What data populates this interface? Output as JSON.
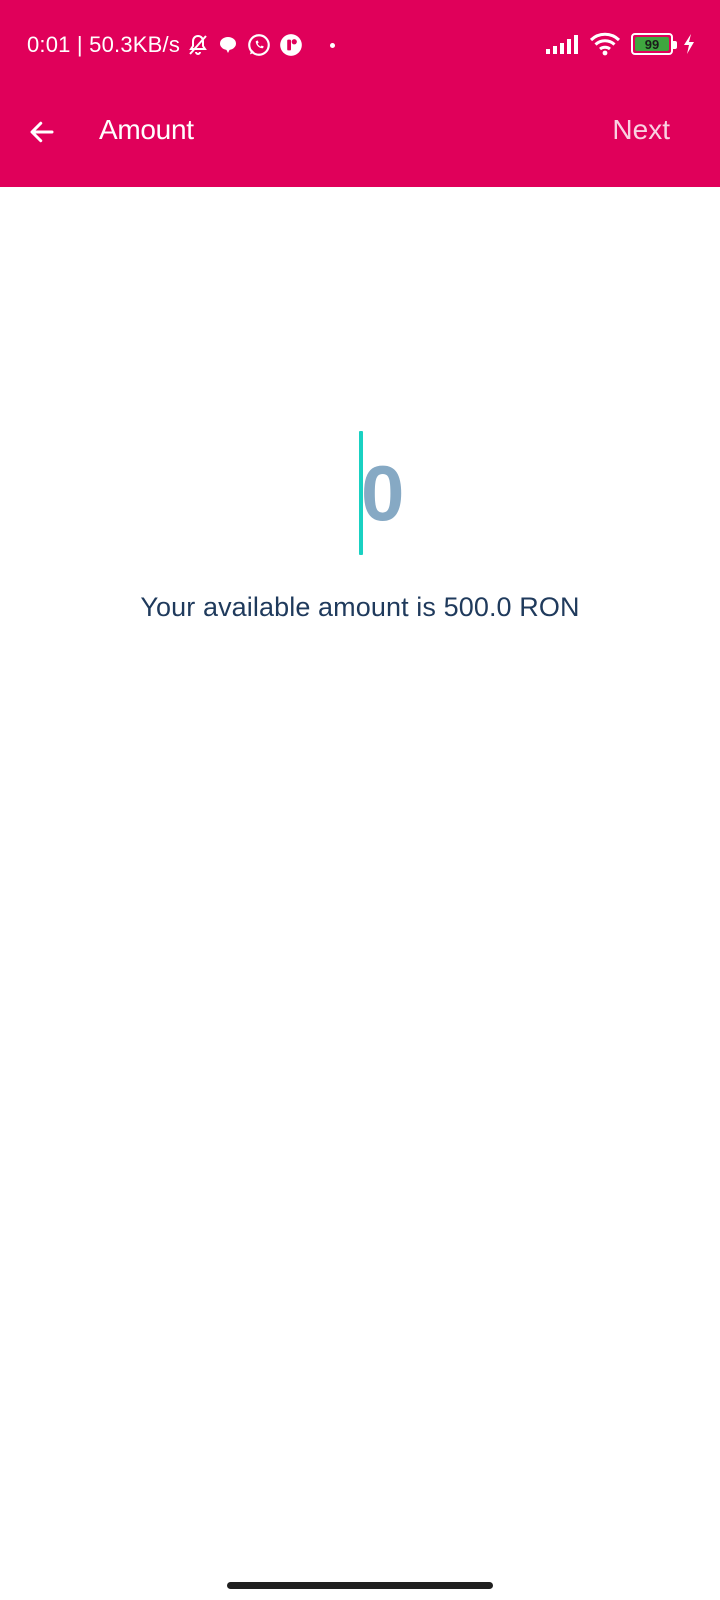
{
  "status_bar": {
    "time_and_speed": "0:01 | 50.3KB/s",
    "battery_level": "99",
    "icons": [
      "bell-off-icon",
      "chat-bubble-icon",
      "whatsapp-icon",
      "notification-app-icon",
      "signal-icon",
      "wifi-icon",
      "battery-icon",
      "charging-icon"
    ]
  },
  "app_bar": {
    "title": "Amount",
    "next_label": "Next",
    "back_icon": "arrow-left-icon"
  },
  "amount": {
    "value": "0",
    "available_text": "Your available amount is 500.0 RON"
  },
  "colors": {
    "header": "#E0005A",
    "amount_placeholder": "#86A9C4",
    "cursor": "#19D1C2",
    "body_text": "#1F3A5C"
  }
}
